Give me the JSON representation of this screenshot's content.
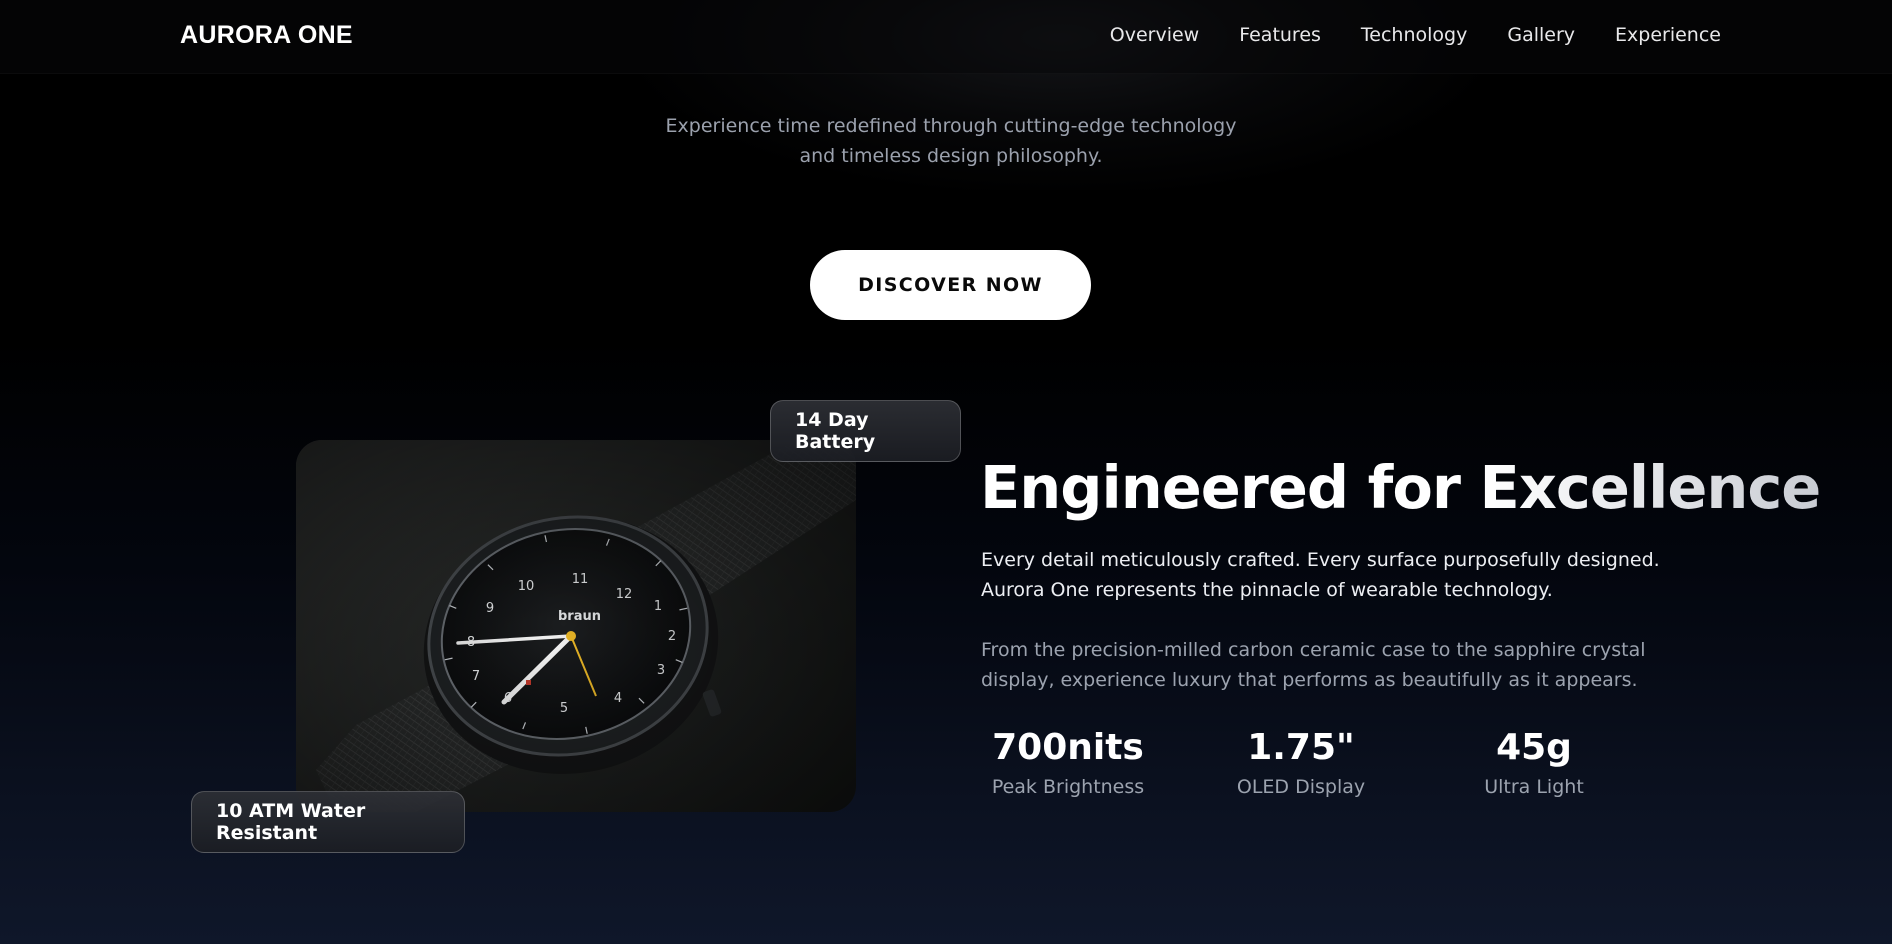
{
  "brand": {
    "name": "AURORA ONE"
  },
  "nav": {
    "items": [
      "Overview",
      "Features",
      "Technology",
      "Gallery",
      "Experience"
    ]
  },
  "hero": {
    "tagline_line1": "Experience time redefined through cutting-edge technology",
    "tagline_line2": "and timeless design philosophy.",
    "cta_label": "DISCOVER NOW"
  },
  "feature": {
    "badges": {
      "battery": "14 Day Battery",
      "water": "10 ATM Water Resistant"
    },
    "headline": "Engineered for Excellence",
    "paragraph1": "Every detail meticulously crafted. Every surface purposefully designed. Aurora One represents the pinnacle of wearable technology.",
    "paragraph2": "From the precision-milled carbon ceramic case to the sapphire crystal display, experience luxury that performs as beautifully as it appears.",
    "stats": [
      {
        "value": "700nits",
        "label": "Peak Brightness"
      },
      {
        "value": "1.75\"",
        "label": "OLED Display"
      },
      {
        "value": "45g",
        "label": "Ultra Light"
      }
    ],
    "photo": {
      "alt": "watch-photo",
      "dial_brand": "braun",
      "dial_numbers": [
        "12",
        "1",
        "2",
        "3",
        "4",
        "5",
        "6",
        "7",
        "8",
        "9",
        "10",
        "11"
      ]
    }
  },
  "colors": {
    "background_top": "#000000",
    "background_bottom": "#0f172a",
    "cta_background": "#ffffff",
    "secondary_hand": "#e8b526",
    "muted_text": "#9ca3af"
  }
}
